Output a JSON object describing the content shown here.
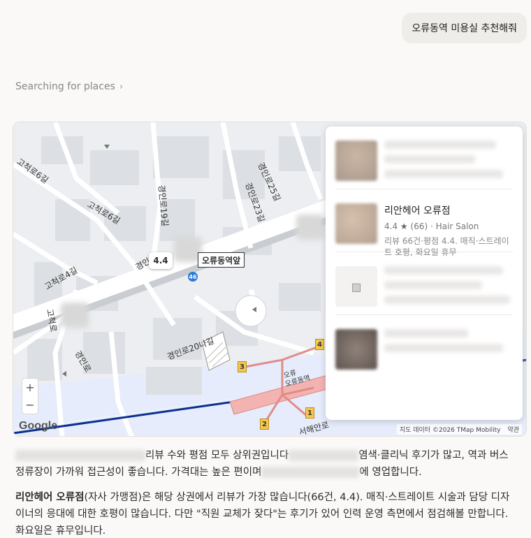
{
  "user_message": "오류동역 미용실 추천해줘",
  "search_status": "Searching for places",
  "map": {
    "roads": [
      "고척로6길",
      "고척로6길",
      "고척로4길",
      "경인로19길",
      "경인로23길",
      "경인로25길",
      "경인로",
      "경인로",
      "경인로20나길",
      "고척로",
      "오류",
      "서해안로",
      "경인로"
    ],
    "road_labels": {
      "r1": "고척로6길",
      "r2": "고척로6길",
      "r3": "고척로4길",
      "r4": "경인로19길",
      "r5": "경인로23길",
      "r6": "경인로25길",
      "r7": "경인로",
      "r8": "경인로",
      "r9": "경인로20나길",
      "r10": "고척로",
      "r11": "오류",
      "r12": "서해안로"
    },
    "pin_rating": "4.4",
    "station_label": "오류동역앞",
    "bus_stop_number": "46",
    "subway_station": "오류동역",
    "subway_station_short": "오류",
    "exits": [
      "1",
      "2",
      "3",
      "4"
    ],
    "attribution": "지도 데이터 ©2026 TMap Mobility",
    "terms": "약관",
    "google": "Google",
    "zoom_in": "+",
    "zoom_out": "−"
  },
  "results": [
    {
      "name": "",
      "rating": "",
      "reviews": "",
      "category": "",
      "desc": ""
    },
    {
      "name": "리안헤어 오류점",
      "rating": "4.4",
      "star": "★",
      "reviews": "(66)",
      "separator": "·",
      "category": "Hair Salon",
      "desc": "리뷰 66건·평점 4.4. 매직·스트레이트 호평, 화요일 휴무"
    },
    {
      "name": "",
      "rating": "",
      "reviews": "",
      "category": "",
      "desc": ""
    },
    {
      "name": "",
      "rating": "",
      "reviews": "",
      "category": "",
      "desc": ""
    }
  ],
  "paragraphs": {
    "p1_part1": "리뷰 수와 평점 모두 상위권입니다",
    "p1_part2": "염색·클리닉 후기가 많고, 역과 버스정류장이 가까워 접근성이 좋습니다. 가격대는 높은 편이며",
    "p1_part3": "에 영업합니다.",
    "p2_bold": "리안헤어 오류점",
    "p2_text": "(자사 가맹점)은 해당 상권에서 리뷰가 가장 많습니다(66건, 4.4). 매직·스트레이트 시술과 담당 디자이너의 응대에 대한 호평이 많습니다. 다만 \"직원 교체가 잦다\"는 후기가 있어 인력 운영 측면에서 점검해볼 만합니다. 화요일은 휴무입니다."
  },
  "colors": {
    "subway_line": "#0c2f8f",
    "water": "#e6ecfb",
    "road": "#ffffff",
    "block": "#dfe1e4",
    "station_area": "#f3b3b0"
  }
}
